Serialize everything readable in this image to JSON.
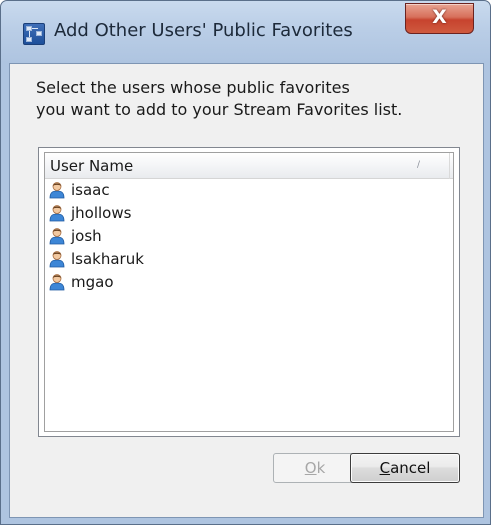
{
  "window": {
    "title": "Add Other Users' Public Favorites",
    "close_glyph": "X"
  },
  "instructions": {
    "line1": "Select the users whose public favorites",
    "line2": "you want to add to your Stream Favorites list."
  },
  "list": {
    "column_header": "User Name",
    "sort_glyph": "∕",
    "users": [
      "isaac",
      "jhollows",
      "josh",
      "lsakharuk",
      "mgao"
    ]
  },
  "buttons": {
    "ok": {
      "mnemonic": "O",
      "rest": "k",
      "enabled": false
    },
    "cancel": {
      "mnemonic": "C",
      "rest": "ancel",
      "enabled": true
    }
  },
  "icons": {
    "app": "stream-app-icon",
    "user": "user-icon",
    "close": "close-icon"
  },
  "colors": {
    "frame": "#aec4e0",
    "close_red": "#c7432e",
    "user_icon_blue": "#3d86d6",
    "disabled_text": "#a7a7a7"
  }
}
